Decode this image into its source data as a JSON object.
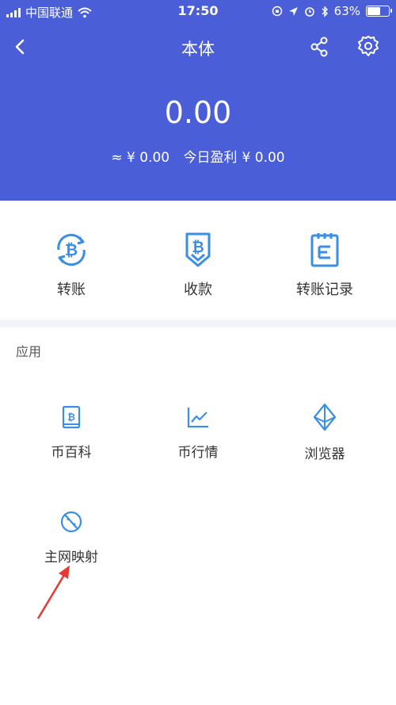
{
  "status_bar": {
    "carrier": "中国联通",
    "time": "17:50",
    "battery": "63%",
    "battery_level": 0.63
  },
  "nav": {
    "title": "本体",
    "back_icon": "chevron-left-icon",
    "share_icon": "share-icon",
    "settings_icon": "gear-icon"
  },
  "balance": {
    "amount": "0.00",
    "approx": "≈ ¥ 0.00",
    "today_label": "今日盈利",
    "today_value": "¥ 0.00"
  },
  "actions": [
    {
      "label": "转账",
      "icon": "bitcoin-transfer-icon"
    },
    {
      "label": "收款",
      "icon": "bitcoin-receive-icon"
    },
    {
      "label": "转账记录",
      "icon": "clipboard-icon"
    }
  ],
  "apps": {
    "section_title": "应用",
    "items": [
      {
        "label": "币百科",
        "icon": "coin-book-icon"
      },
      {
        "label": "币行情",
        "icon": "chart-line-icon"
      },
      {
        "label": "浏览器",
        "icon": "ethereum-icon"
      },
      {
        "label": "主网映射",
        "icon": "mainnet-icon"
      }
    ]
  },
  "colors": {
    "header_bg": "#4a5ed8",
    "accent": "#3a8ee6",
    "arrow": "#e53935"
  }
}
